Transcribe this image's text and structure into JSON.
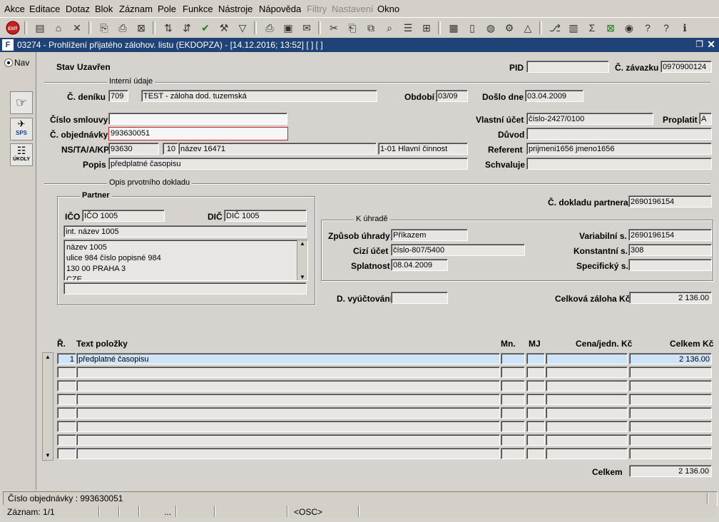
{
  "menu": [
    "Akce",
    "Editace",
    "Dotaz",
    "Blok",
    "Záznam",
    "Pole",
    "Funkce",
    "Nástroje",
    "Nápověda",
    "Filtry",
    "Nastavení",
    "Okno"
  ],
  "menu_disabled": [
    "Filtry",
    "Nastavení"
  ],
  "window": {
    "title": "03274 - Prohlížení přijatého zálohov. listu (EKDOPZA) - [14.12.2016; 13:52]  [ ]  [ ]"
  },
  "left": {
    "nav_label": "Nav",
    "sps_label": "SPS",
    "ukoly_label": "ÚKOLY"
  },
  "header": {
    "stav_label": "Stav",
    "stav_value": "Uzavřen",
    "pid_label": "PID",
    "pid_value": "",
    "zavazku_label": "Č. závazku",
    "zavazku_value": "0970900124"
  },
  "interni": {
    "group_title": "Interní údaje",
    "denik_label": "Č. deníku",
    "denik_value": "709",
    "denik_text": "TEST - záloha dod. tuzemská",
    "obdobi_label": "Období",
    "obdobi_value": "03/09",
    "doslo_label": "Došlo dne",
    "doslo_value": "03.04.2009",
    "smlouvy_label": "Číslo smlouvy",
    "smlouvy_value": "",
    "vlastni_label": "Vlastní účet",
    "vlastni_value": "číslo-2427/0100",
    "proplatit_label": "Proplatit",
    "proplatit_value": "A",
    "objednavky_label": "Č. objednávky",
    "objednavky_value": "993630051",
    "duvod_label": "Důvod",
    "duvod_value": "",
    "ns_label": "NS/TA/A/KP",
    "ns_value": "93630",
    "ta_value": "10",
    "a_value": "název 16471",
    "kp_value": "1-01 Hlavní činnost",
    "referent_label": "Referent",
    "referent_value": "prijmeni1656 jmeno1656",
    "popis_label": "Popis",
    "popis_value": "předplatné časopisu",
    "schvaluje_label": "Schvaluje",
    "schvaluje_value": ""
  },
  "opis": {
    "group_title": "Opis prvotního dokladu",
    "partner_title": "Partner",
    "ico_label": "IČO",
    "ico_value": "IČO 1005",
    "dic_label": "DIČ",
    "dic_value": "DIČ 1005",
    "int_nazev": "int. název 1005",
    "address_lines": [
      "název 1005",
      "ulice 984 číslo popisné 984",
      "130 00 PRAHA 3",
      "CZE"
    ],
    "extra": "",
    "doklad_label": "Č. dokladu partnera",
    "doklad_value": "2690196154",
    "k_uhrade_title": "K úhradě",
    "zpusob_label": "Způsob úhrady",
    "zpusob_value": "Příkazem",
    "cizi_label": "Cizí účet",
    "cizi_value": "číslo-807/5400",
    "splatnost_label": "Splatnost",
    "splatnost_value": "08.04.2009",
    "variabilni_label": "Variabilní s.",
    "variabilni_value": "2690196154",
    "konstantni_label": "Konstantní s.",
    "konstantni_value": "308",
    "specificky_label": "Specifický s.",
    "specificky_value": "",
    "vyuctovani_label": "D. vyúčtování",
    "vyuctovani_value": "",
    "zaloha_label": "Celková záloha Kč",
    "zaloha_value": "2 136.00"
  },
  "items": {
    "headers": {
      "r": "Ř.",
      "text": "Text položky",
      "mn": "Mn.",
      "mj": "MJ",
      "cena": "Cena/jedn. Kč",
      "celkem": "Celkem Kč"
    },
    "rows": [
      {
        "r": "1",
        "text": "předplatné časopisu",
        "mn": "",
        "mj": "",
        "cena": "",
        "celkem": "2 136.00"
      },
      {
        "r": "",
        "text": "",
        "mn": "",
        "mj": "",
        "cena": "",
        "celkem": ""
      },
      {
        "r": "",
        "text": "",
        "mn": "",
        "mj": "",
        "cena": "",
        "celkem": ""
      },
      {
        "r": "",
        "text": "",
        "mn": "",
        "mj": "",
        "cena": "",
        "celkem": ""
      },
      {
        "r": "",
        "text": "",
        "mn": "",
        "mj": "",
        "cena": "",
        "celkem": ""
      },
      {
        "r": "",
        "text": "",
        "mn": "",
        "mj": "",
        "cena": "",
        "celkem": ""
      },
      {
        "r": "",
        "text": "",
        "mn": "",
        "mj": "",
        "cena": "",
        "celkem": ""
      },
      {
        "r": "",
        "text": "",
        "mn": "",
        "mj": "",
        "cena": "",
        "celkem": ""
      }
    ],
    "total_label": "Celkem",
    "total_value": "2 136.00"
  },
  "status": {
    "message": "Číslo objednávky : 993630051",
    "record": "Záznam: 1/1",
    "dots": "...",
    "osc": "<OSC>"
  },
  "colors": {
    "titlebar": "#1f4277",
    "selected_row": "#cfe3f8",
    "error_border": "#d02020"
  }
}
